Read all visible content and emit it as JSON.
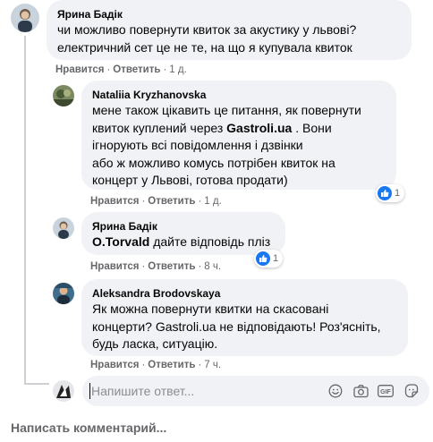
{
  "comments": [
    {
      "author": "Ярина Бадік",
      "text": "чи можливо повернути квиток за акустику у львові?\nелектричний сет це не те, на що я купувала квиток",
      "like": "Нравится",
      "reply": "Ответить",
      "time": "1 д."
    },
    {
      "author": "Nataliia Kryzhanovska",
      "text_before": "мене також цікавить це питання, як повернути\nквиток куплений через ",
      "text_bold": "Gastroli.ua",
      "text_after": " . Вони\nігнорують всі повідомлення і дзвінки\nабо ж можливо комусь потрібен квиток на\nконцерт у Львові, готова продати)",
      "like": "Нравится",
      "reply": "Ответить",
      "time": "1 д.",
      "reactions": "1"
    },
    {
      "author": "Ярина Бадік",
      "mention": "O.Torvald",
      "text_after": " дайте відповідь пліз",
      "like": "Нравится",
      "reply": "Ответить",
      "time": "8 ч.",
      "reactions": "1"
    },
    {
      "author": "Aleksandra Brodovskaya",
      "text": "Як можна повернути квитки на скасовані\nконцерти? Gastroli.ua не відповідають! Роз'ясніть,\nбудь ласка, ситуацію.",
      "like": "Нравится",
      "reply": "Ответить",
      "time": "7 ч."
    }
  ],
  "reply_box": {
    "placeholder": "Напишите ответ...",
    "tools": [
      "smile-icon",
      "camera-icon",
      "gif-icon",
      "sticker-icon"
    ]
  },
  "write_comment": "Написать комментарий...",
  "separator": "·",
  "colors": {
    "bubble": "#f0f2f5",
    "meta": "#65676b",
    "like_blue": "#1877f2",
    "text": "#050505"
  }
}
